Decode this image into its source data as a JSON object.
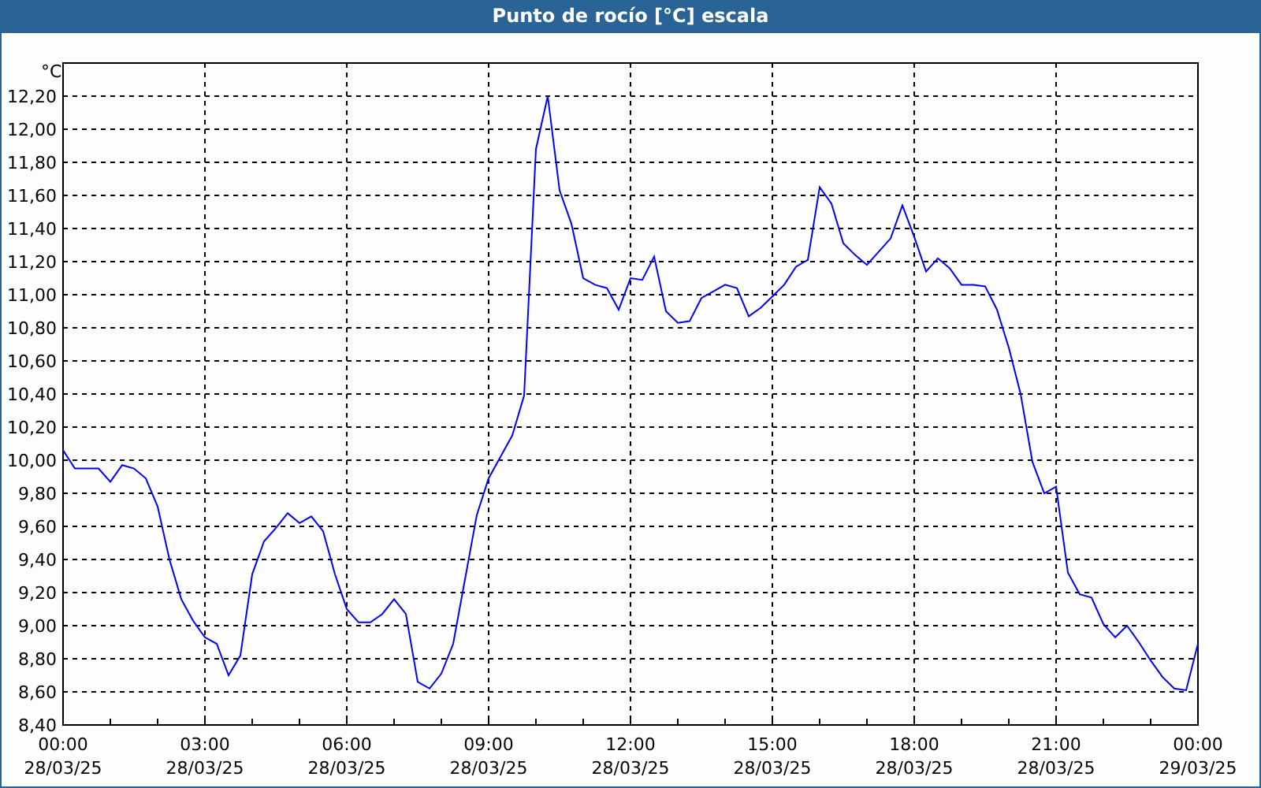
{
  "window": {
    "title": "Punto de rocío [°C] escala"
  },
  "chart_data": {
    "type": "line",
    "grid": true,
    "ylabel": "°C",
    "ylim": [
      8.4,
      12.4
    ],
    "categories": [
      "00:00\n28/03/25",
      null,
      null,
      null,
      null,
      null,
      null,
      null,
      null,
      null,
      null,
      null,
      "03:00\n28/03/25",
      null,
      null,
      null,
      null,
      null,
      null,
      null,
      null,
      null,
      null,
      null,
      "06:00\n28/03/25",
      null,
      null,
      null,
      null,
      null,
      null,
      null,
      null,
      null,
      null,
      null,
      "09:00\n28/03/25",
      null,
      null,
      null,
      null,
      null,
      null,
      null,
      null,
      null,
      null,
      null,
      "12:00\n28/03/25",
      null,
      null,
      null,
      null,
      null,
      null,
      null,
      null,
      null,
      null,
      null,
      "15:00\n28/03/25",
      null,
      null,
      null,
      null,
      null,
      null,
      null,
      null,
      null,
      null,
      null,
      "18:00\n28/03/25",
      null,
      null,
      null,
      null,
      null,
      null,
      null,
      null,
      null,
      null,
      null,
      "21:00\n28/03/25",
      null,
      null,
      null,
      null,
      null,
      null,
      null,
      null,
      null,
      null,
      null,
      "00:00\n29/03/25"
    ],
    "yticks": [
      {
        "value": 8.4,
        "label": "8,40"
      },
      {
        "value": 8.6,
        "label": "8,60"
      },
      {
        "value": 8.8,
        "label": "8,80"
      },
      {
        "value": 9.0,
        "label": "9,00"
      },
      {
        "value": 9.2,
        "label": "9,20"
      },
      {
        "value": 9.4,
        "label": "9,40"
      },
      {
        "value": 9.6,
        "label": "9,60"
      },
      {
        "value": 9.8,
        "label": "9,80"
      },
      {
        "value": 10.0,
        "label": "10,00"
      },
      {
        "value": 10.2,
        "label": "10,20"
      },
      {
        "value": 10.4,
        "label": "10,40"
      },
      {
        "value": 10.6,
        "label": "10,60"
      },
      {
        "value": 10.8,
        "label": "10,80"
      },
      {
        "value": 11.0,
        "label": "11,00"
      },
      {
        "value": 11.2,
        "label": "11,20"
      },
      {
        "value": 11.4,
        "label": "11,40"
      },
      {
        "value": 11.6,
        "label": "11,60"
      },
      {
        "value": 11.8,
        "label": "11,80"
      },
      {
        "value": 12.0,
        "label": "12,00"
      },
      {
        "value": 12.2,
        "label": "12,20"
      }
    ],
    "series": [
      {
        "color": "#0000ff",
        "values": [
          10.06,
          9.95,
          9.95,
          9.95,
          9.87,
          9.97,
          9.95,
          9.89,
          9.72,
          9.4,
          9.16,
          9.03,
          8.93,
          8.89,
          8.7,
          8.82,
          9.31,
          9.51,
          9.59,
          9.68,
          9.62,
          9.66,
          9.57,
          9.31,
          9.1,
          9.02,
          9.02,
          9.07,
          9.16,
          9.07,
          8.66,
          8.62,
          8.71,
          8.89,
          9.28,
          9.67,
          9.89,
          10.02,
          10.15,
          10.39,
          11.88,
          12.2,
          11.63,
          11.43,
          11.1,
          11.06,
          11.04,
          10.91,
          11.1,
          11.09,
          11.23,
          10.9,
          10.83,
          10.84,
          10.98,
          11.02,
          11.06,
          11.04,
          10.87,
          10.92,
          10.99,
          11.06,
          11.17,
          11.21,
          11.65,
          11.55,
          11.31,
          11.24,
          11.18,
          11.26,
          11.34,
          11.54,
          11.35,
          11.14,
          11.22,
          11.16,
          11.06,
          11.06,
          11.05,
          10.91,
          10.68,
          10.4,
          9.99,
          9.8,
          9.84,
          9.32,
          9.19,
          9.17,
          9.01,
          8.93,
          9.0,
          8.9,
          8.79,
          8.69,
          8.62,
          8.61,
          8.89
        ]
      }
    ]
  }
}
